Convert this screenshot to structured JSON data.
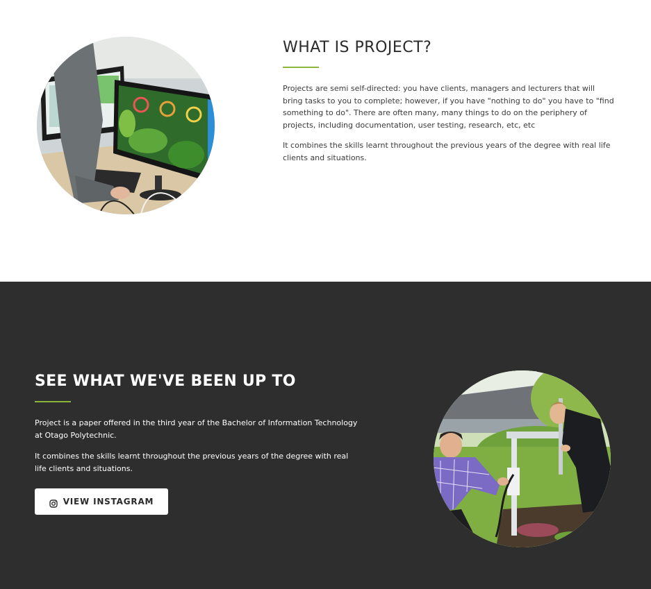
{
  "about": {
    "heading": "WHAT IS PROJECT?",
    "paragraphs": [
      "Projects are semi self-directed: you have clients, managers and lecturers that will bring tasks to you to complete; however, if you have \"nothing to do\" you have to \"find something to do\". There are often many, many things to do on the periphery of projects, including documentation, user testing, research, etc, etc",
      "It combines the skills learnt throughout the previous years of the degree with real life clients and situations."
    ]
  },
  "instagram_section": {
    "heading": "SEE WHAT WE'VE BEEN UP TO",
    "paragraphs": [
      "Project is a paper offered in the third year of the Bachelor of Information Technology at Otago Polytechnic.",
      "It combines the skills learnt throughout the previous years of the degree with real life clients and situations."
    ],
    "button_label": "VIEW INSTAGRAM",
    "button_icon": "instagram-icon"
  },
  "colors": {
    "accent": "#8cb53b",
    "dark_background": "#2e2e2e",
    "light_background": "#ffffff"
  }
}
